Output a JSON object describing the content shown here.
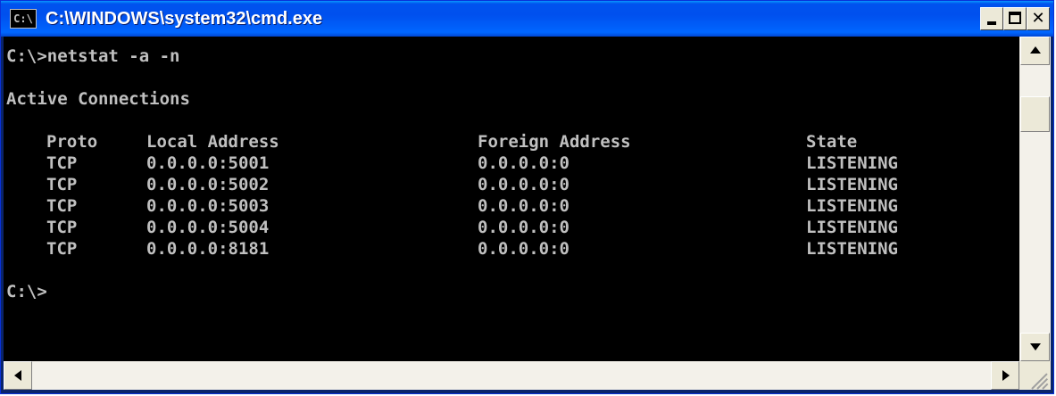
{
  "window": {
    "title": "C:\\WINDOWS\\system32\\cmd.exe",
    "icon_label": "C:\\",
    "icon_name": "cmd-console-icon",
    "titlebar_color": "#0058ee"
  },
  "controls": {
    "minimize_icon": "minimize-icon",
    "maximize_icon": "maximize-icon",
    "close_icon": "close-icon",
    "close_glyph": "✕"
  },
  "console": {
    "background": "#000000",
    "foreground": "#c0c0c0",
    "command_line": "C:\\>netstat -a -n",
    "section_title": "Active Connections",
    "headers": {
      "proto": "Proto",
      "local": "Local Address",
      "foreign": "Foreign Address",
      "state": "State"
    },
    "rows": [
      {
        "proto": "TCP",
        "local": "0.0.0.0:5001",
        "foreign": "0.0.0.0:0",
        "state": "LISTENING"
      },
      {
        "proto": "TCP",
        "local": "0.0.0.0:5002",
        "foreign": "0.0.0.0:0",
        "state": "LISTENING"
      },
      {
        "proto": "TCP",
        "local": "0.0.0.0:5003",
        "foreign": "0.0.0.0:0",
        "state": "LISTENING"
      },
      {
        "proto": "TCP",
        "local": "0.0.0.0:5004",
        "foreign": "0.0.0.0:0",
        "state": "LISTENING"
      },
      {
        "proto": "TCP",
        "local": "0.0.0.0:8181",
        "foreign": "0.0.0.0:0",
        "state": "LISTENING"
      }
    ],
    "prompt": "C:\\>"
  },
  "scrollbars": {
    "up_icon": "scroll-up-arrow-icon",
    "down_icon": "scroll-down-arrow-icon",
    "left_icon": "scroll-left-arrow-icon",
    "right_icon": "scroll-right-arrow-icon"
  }
}
